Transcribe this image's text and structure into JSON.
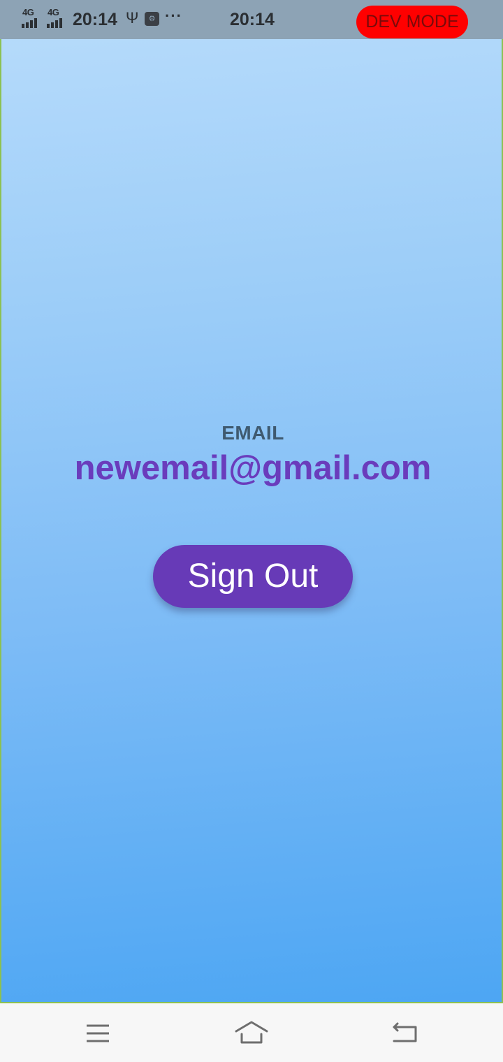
{
  "status_bar": {
    "signal_1": "4G",
    "signal_2": "4G",
    "time_left": "20:14",
    "more": "···",
    "time_center": "20:14",
    "dev_badge": "DEV MODE",
    "usb_icon": "usb-icon",
    "app_icon": "usb-debug-icon"
  },
  "profile": {
    "email_label": "EMAIL",
    "email_value": "newemail@gmail.com",
    "sign_out_label": "Sign Out"
  },
  "nav_bar": {
    "menu_icon": "menu-icon",
    "home_icon": "home-icon",
    "back_icon": "back-icon"
  },
  "colors": {
    "accent": "#673ab7",
    "email_text": "#6a3cbc",
    "dev_badge": "#ff0000",
    "status_bar": "#8da3b5",
    "gradient_top": "#b8dcfb",
    "gradient_bottom": "#4da6f3"
  }
}
